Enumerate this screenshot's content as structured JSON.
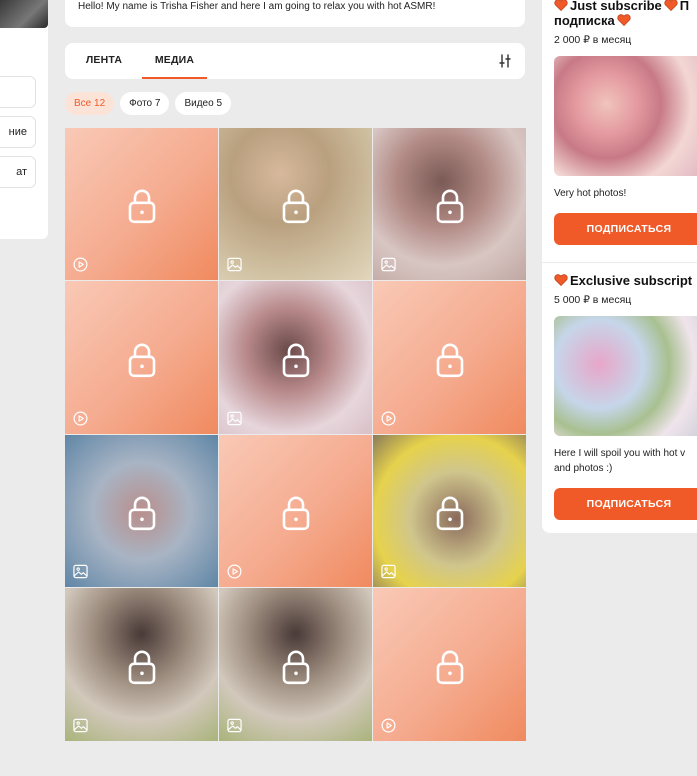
{
  "sidebar": {
    "buttons": [
      "ние",
      "ат"
    ]
  },
  "bio": {
    "text": "Hello! My name is Trisha Fisher and here I am going to relax you with hot ASMR!"
  },
  "tabs": [
    {
      "label": "ЛЕНТА",
      "active": false
    },
    {
      "label": "МЕДИА",
      "active": true
    }
  ],
  "filters": [
    {
      "label": "Все 12",
      "active": true
    },
    {
      "label": "Фото 7",
      "active": false
    },
    {
      "label": "Видео 5",
      "active": false
    }
  ],
  "media": [
    {
      "type": "video",
      "style": "bg-grad"
    },
    {
      "type": "photo",
      "style": "bg-b1"
    },
    {
      "type": "photo",
      "style": "bg-b2"
    },
    {
      "type": "video",
      "style": "bg-grad"
    },
    {
      "type": "photo",
      "style": "bg-b3"
    },
    {
      "type": "video",
      "style": "bg-grad"
    },
    {
      "type": "photo",
      "style": "bg-b4"
    },
    {
      "type": "video",
      "style": "bg-grad"
    },
    {
      "type": "photo",
      "style": "bg-b5"
    },
    {
      "type": "photo",
      "style": "bg-b6"
    },
    {
      "type": "photo",
      "style": "bg-b6"
    },
    {
      "type": "video",
      "style": "bg-grad"
    }
  ],
  "plans": [
    {
      "title_line1": "Just subscribe",
      "title_line1_suffix": "П",
      "title_line2": "подписка",
      "price": "2 000 ₽ в месяц",
      "description": "Very hot photos!",
      "button": "ПОДПИСАТЬСЯ"
    },
    {
      "title_line1": "Exclusive subscript",
      "price": "5 000 ₽ в месяц",
      "description_line1": "Here I will spoil you with hot v",
      "description_line2": "and photos :)",
      "button": "ПОДПИСАТЬСЯ"
    }
  ],
  "colors": {
    "accent": "#f05a28",
    "background": "#ebebeb"
  }
}
